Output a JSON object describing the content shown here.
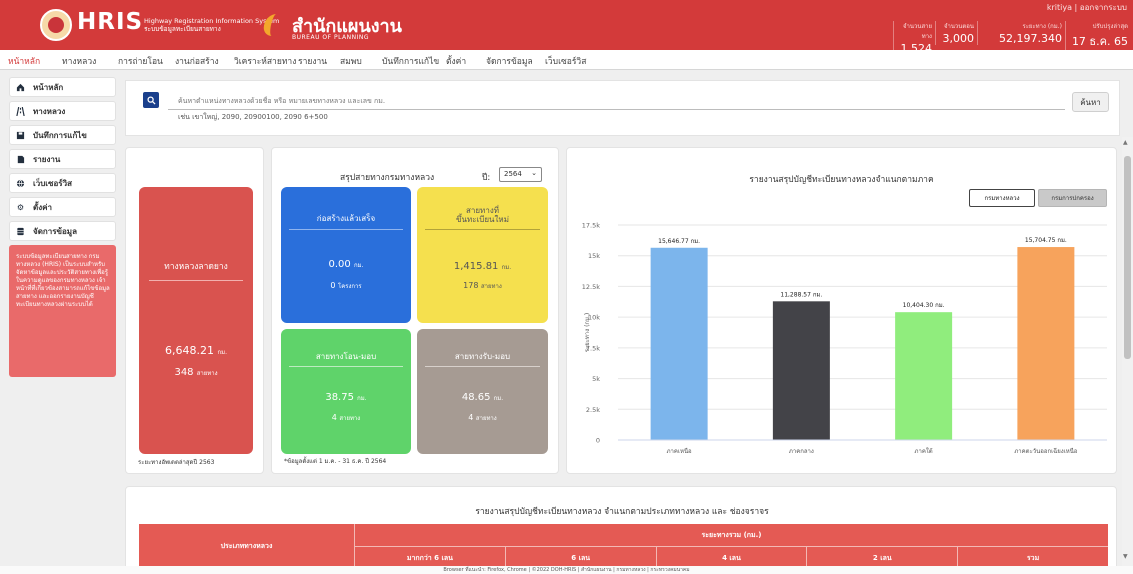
{
  "header": {
    "logo_text": "HRIS",
    "logo_sub1": "Highway Registration Information System",
    "logo_sub2": "ระบบข้อมูลทะเบียนสายทาง",
    "bureau_th": "สำนักแผนงาน",
    "bureau_en": "BUREAU OF PLANNING",
    "user": "kritiya | ออกจากระบบ",
    "stats": [
      {
        "label": "จำนวนสายทาง",
        "value": "1,524"
      },
      {
        "label": "จำนวนตอน",
        "value": "3,000"
      },
      {
        "label": "ระยะทาง (กม.)",
        "value": "52,197.340"
      },
      {
        "label": "ปรับปรุงล่าสุด",
        "value": "17 ธ.ค. 65"
      }
    ]
  },
  "nav": [
    "หน้าหลัก",
    "ทางหลวง",
    "การถ่ายโอน",
    "งานก่อสร้าง",
    "วิเคราะห์สายทาง",
    "รายงาน",
    "สมพบ",
    "บันทึกการแก้ไข",
    "ตั้งค่า",
    "จัดการข้อมูล",
    "เว็บเซอร์วิส"
  ],
  "sidebar": {
    "items": [
      {
        "label": "หน้าหลัก",
        "icon": "home-icon"
      },
      {
        "label": "ทางหลวง",
        "icon": "road-icon"
      },
      {
        "label": "บันทึกการแก้ไข",
        "icon": "save-icon"
      },
      {
        "label": "รายงาน",
        "icon": "report-icon"
      },
      {
        "label": "เว็บเซอร์วิส",
        "icon": "globe-icon"
      },
      {
        "label": "ตั้งค่า",
        "icon": "gear-icon"
      },
      {
        "label": "จัดการข้อมูล",
        "icon": "database-icon"
      }
    ],
    "info": "ระบบข้อมูลทะเบียนสายทาง กรมทางหลวง (HRIS) เป็นระบบสำหรับจัดหาข้อมูลและประวัติสายทางเพื่อรู้ในความดูแลของกรมทางหลวง เจ้าหน้าที่ที่เกี่ยวข้องสามารถแก้ไขข้อมูลสายทาง และออกรายงานบัญชีทะเบียนทางหลวงผ่านระบบได้"
  },
  "search": {
    "placeholder": "ค้นหาตำแหน่งทางหลวงด้วยชื่อ หรือ หมายเลขทางหลวง และเลข กม.",
    "hint": "เช่น เขาใหญ่, 2090, 20900100, 2090 6+500",
    "button": "ค้นหา"
  },
  "red_card": {
    "title": "ทางหลวงลาดยาง",
    "km": "6,648.21",
    "km_unit": "กม.",
    "count": "348",
    "count_unit": "สายทาง",
    "note": "ระยะทางอัพเดตล่าสุดปี 2563"
  },
  "summary": {
    "title": "สรุปสายทางกรมทางหลวง",
    "year_label": "ปี:",
    "year": "2564",
    "boxes": [
      {
        "title": "ก่อสร้างแล้วเสร็จ",
        "value": "0.00",
        "unit": "กม.",
        "count": "0",
        "count_unit": "โครงการ",
        "color": "#2a6fdb"
      },
      {
        "title": "สายทางที่\nขึ้นทะเบียนใหม่",
        "value": "1,415.81",
        "unit": "กม.",
        "count": "178",
        "count_unit": "สายทาง",
        "color": "#f5e04e"
      },
      {
        "title": "สายทางโอน-มอบ",
        "value": "38.75",
        "unit": "กม.",
        "count": "4",
        "count_unit": "สายทาง",
        "color": "#5fd36a"
      },
      {
        "title": "สายทางรับ-มอบ",
        "value": "48.65",
        "unit": "กม.",
        "count": "4",
        "count_unit": "สายทาง",
        "color": "#a69b93"
      }
    ],
    "note": "*ข้อมูลตั้งแต่ 1 ม.ค. - 31 ธ.ค. ปี 2564"
  },
  "region_chart": {
    "tabs": [
      "กรมทางหลวง",
      "กรมการปกครอง"
    ]
  },
  "chart_data": {
    "type": "bar",
    "title": "รายงานสรุปบัญชีทะเบียนทางหลวงจำแนกตามภาค",
    "categories": [
      "ภาคเหนือ",
      "ภาคกลาง",
      "ภาคใต้",
      "ภาคตะวันออกเฉียงเหนือ"
    ],
    "values": [
      15646.77,
      11288.57,
      10404.3,
      15704.75
    ],
    "labels": [
      "15,646.77 กม.",
      "11,288.57 กม.",
      "10,404.30 กม.",
      "15,704.75 กม."
    ],
    "colors": [
      "#7cb5ec",
      "#434348",
      "#90ed7d",
      "#f7a35c"
    ],
    "ylabel": "ระยะทาง (กม.)",
    "ylim": [
      0,
      17500
    ],
    "yticks": [
      "0",
      "2.5k",
      "5k",
      "7.5k",
      "10k",
      "12.5k",
      "15k",
      "17.5k"
    ]
  },
  "bottom": {
    "title": "รายงานสรุปบัญชีทะเบียนทางหลวง จำแนกตามประเภททางหลวง และ ช่องจราจร",
    "type_header": "ประเภททางหลวง",
    "dist_header": "ระยะทางรวม (กม.)",
    "sub_headers": [
      "มากกว่า 6 เลน",
      "6 เลน",
      "4 เลน",
      "2 เลน",
      "รวม"
    ]
  },
  "footer": "Browser ที่แนะนำ: Firefox, Chrome  |  ©2022 DOH-HRIS  |  สำนักแผนงาน  |  กรมทางหลวง  |  กระทรวงคมนาคม"
}
